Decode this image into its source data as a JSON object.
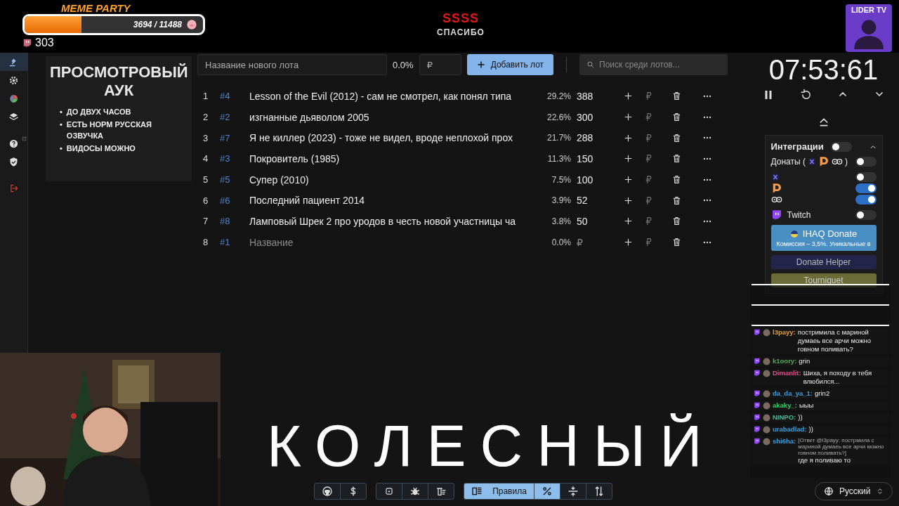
{
  "stream_overlay": {
    "goal": {
      "title": "MEME PARTY",
      "progress": "3694 / 11488",
      "level": 0.32
    },
    "viewers": "303",
    "alert": {
      "title": "SSSS",
      "subtitle": "СПАСИБО"
    },
    "channel_badge": "LIDER TV",
    "caption": "КОЛЕСНЫЙ"
  },
  "sidebar": {
    "items": [
      {
        "selected": true
      },
      {
        "selected": false
      },
      {
        "selected": false
      },
      {
        "selected": false
      },
      {
        "selected": false
      },
      {
        "selected": false
      },
      {
        "selected": false
      }
    ]
  },
  "rules": {
    "title": "ПРОСМОТРОВЫЙ АУК",
    "items": [
      {
        "marker": "•",
        "text": "ДО ДВУХ ЧАСОВ"
      },
      {
        "marker": "•",
        "text": "ЕСТЬ НОРМ РУССКАЯ ОЗВУЧКА"
      },
      {
        "marker": "•",
        "text": "ВИДОСЫ МОЖНО"
      }
    ]
  },
  "new_lot": {
    "name_placeholder": "Название нового лота",
    "percent": "0.0%",
    "amount_placeholder": "₽",
    "add_button": "Добавить лот",
    "search_placeholder": "Поиск среди лотов..."
  },
  "lots": [
    {
      "index": "1",
      "id": "#4",
      "name": "Lesson of the Evil (2012) - сам не смотрел, как понял типа",
      "percent": "29.2%",
      "amount": "388"
    },
    {
      "index": "2",
      "id": "#2",
      "name": "изгнанные дьяволом 2005",
      "percent": "22.6%",
      "amount": "300"
    },
    {
      "index": "3",
      "id": "#7",
      "name": "Я не киллер (2023) - тоже не видел, вроде неплохой прох",
      "percent": "21.7%",
      "amount": "288"
    },
    {
      "index": "4",
      "id": "#3",
      "name": "Покровитель (1985)",
      "percent": "11.3%",
      "amount": "150"
    },
    {
      "index": "5",
      "id": "#5",
      "name": "Супер (2010)",
      "percent": "7.5%",
      "amount": "100"
    },
    {
      "index": "6",
      "id": "#6",
      "name": "Последний пациент 2014",
      "percent": "3.9%",
      "amount": "52"
    },
    {
      "index": "7",
      "id": "#8",
      "name": "Ламповый Шрек 2 про уродов в честь новой участницы ча",
      "percent": "3.8%",
      "amount": "50"
    },
    {
      "index": "8",
      "id": "#1",
      "name_placeholder": "Название",
      "percent": "0.0%",
      "amount_placeholder": "₽"
    }
  ],
  "timer": {
    "time": "07:53:61"
  },
  "integrations": {
    "title": "Интеграции",
    "on": false,
    "expanded": true,
    "donations": {
      "label": "Донаты (",
      "close": ")",
      "on": false
    },
    "services": [
      {
        "kind": "x",
        "on": false
      },
      {
        "kind": "d",
        "on": true
      },
      {
        "kind": "loop",
        "on": true
      }
    ],
    "twitch": {
      "label": "Twitch",
      "on": false
    },
    "ihaq": {
      "label": "IHAQ Donate",
      "note": "Комиссия – 3,5%. Уникальные в"
    },
    "donate_helper": "Donate Helper",
    "tourniquet": "Tourniquet"
  },
  "chat": [
    {
      "user": "l3payy:",
      "color": "#e0a040",
      "text": "постримила с мариной думаеь все арчи можно говном поливать?"
    },
    {
      "user": "k1oory:",
      "color": "#4caf50",
      "text": "grin"
    },
    {
      "user": "Dimanlit:",
      "color": "#e0508a",
      "text": "Шиха, я походу в тебя влюбился..."
    },
    {
      "user": "da_da_ya_1:",
      "color": "#3a9ee0",
      "text": "grin2"
    },
    {
      "user": "akaky_:",
      "color": "#30d060",
      "text": "ыыы"
    },
    {
      "user": "NINPO:",
      "color": "#40c0a0",
      "text": "))"
    },
    {
      "user": "urabadlad:",
      "color": "#3a9ee0",
      "text": "))"
    },
    {
      "user": "shi6ha:",
      "color": "#3a9ee0",
      "reply": "[Ответ @l3payy: пострмила с мариной думаеь все арчи можно говном поливать?]",
      "text": "где я поливаю то"
    }
  ],
  "toolbar": {
    "groups": [
      [
        {
          "kind": "github",
          "selected": false
        },
        {
          "kind": "dollar",
          "selected": false
        }
      ],
      [
        {
          "kind": "box",
          "selected": false
        },
        {
          "kind": "bug",
          "selected": false
        },
        {
          "kind": "clear",
          "selected": false
        }
      ],
      [
        {
          "kind": "rules",
          "label": "Правила",
          "selected": true
        },
        {
          "kind": "percent",
          "selected": true
        },
        {
          "kind": "compress",
          "selected": false
        },
        {
          "kind": "sort",
          "selected": false
        }
      ]
    ]
  },
  "language": "Русский"
}
